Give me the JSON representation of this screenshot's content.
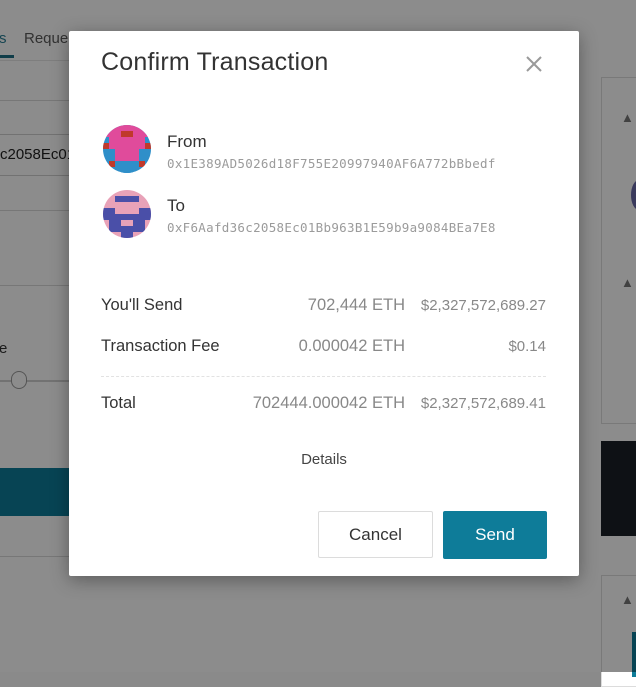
{
  "background": {
    "tab_partial_1": "s",
    "tab_partial_2": "Reque",
    "address_partial": "c2058Ec01",
    "label_partial": "e"
  },
  "modal": {
    "title": "Confirm Transaction",
    "from": {
      "label": "From",
      "address": "0x1E389AD5026d18F755E20997940AF6A772bBbedf"
    },
    "to": {
      "label": "To",
      "address": "0xF6Aafd36c2058Ec01Bb963B1E59b9a9084BEa7E8"
    },
    "send_row": {
      "label": "You'll Send",
      "eth": "702,444 ETH",
      "usd": "$2,327,572,689.27"
    },
    "fee_row": {
      "label": "Transaction Fee",
      "eth": "0.000042 ETH",
      "usd": "$0.14"
    },
    "total_row": {
      "label": "Total",
      "eth": "702444.000042 ETH",
      "usd": "$2,327,572,689.41"
    },
    "details_label": "Details",
    "cancel_label": "Cancel",
    "send_label": "Send"
  },
  "colors": {
    "accent": "#0e7c99",
    "overlay": "rgba(0,0,0,0.45)"
  },
  "icons": {
    "close": "close-icon",
    "from_avatar": "identicon-avatar",
    "to_avatar": "identicon-avatar"
  }
}
